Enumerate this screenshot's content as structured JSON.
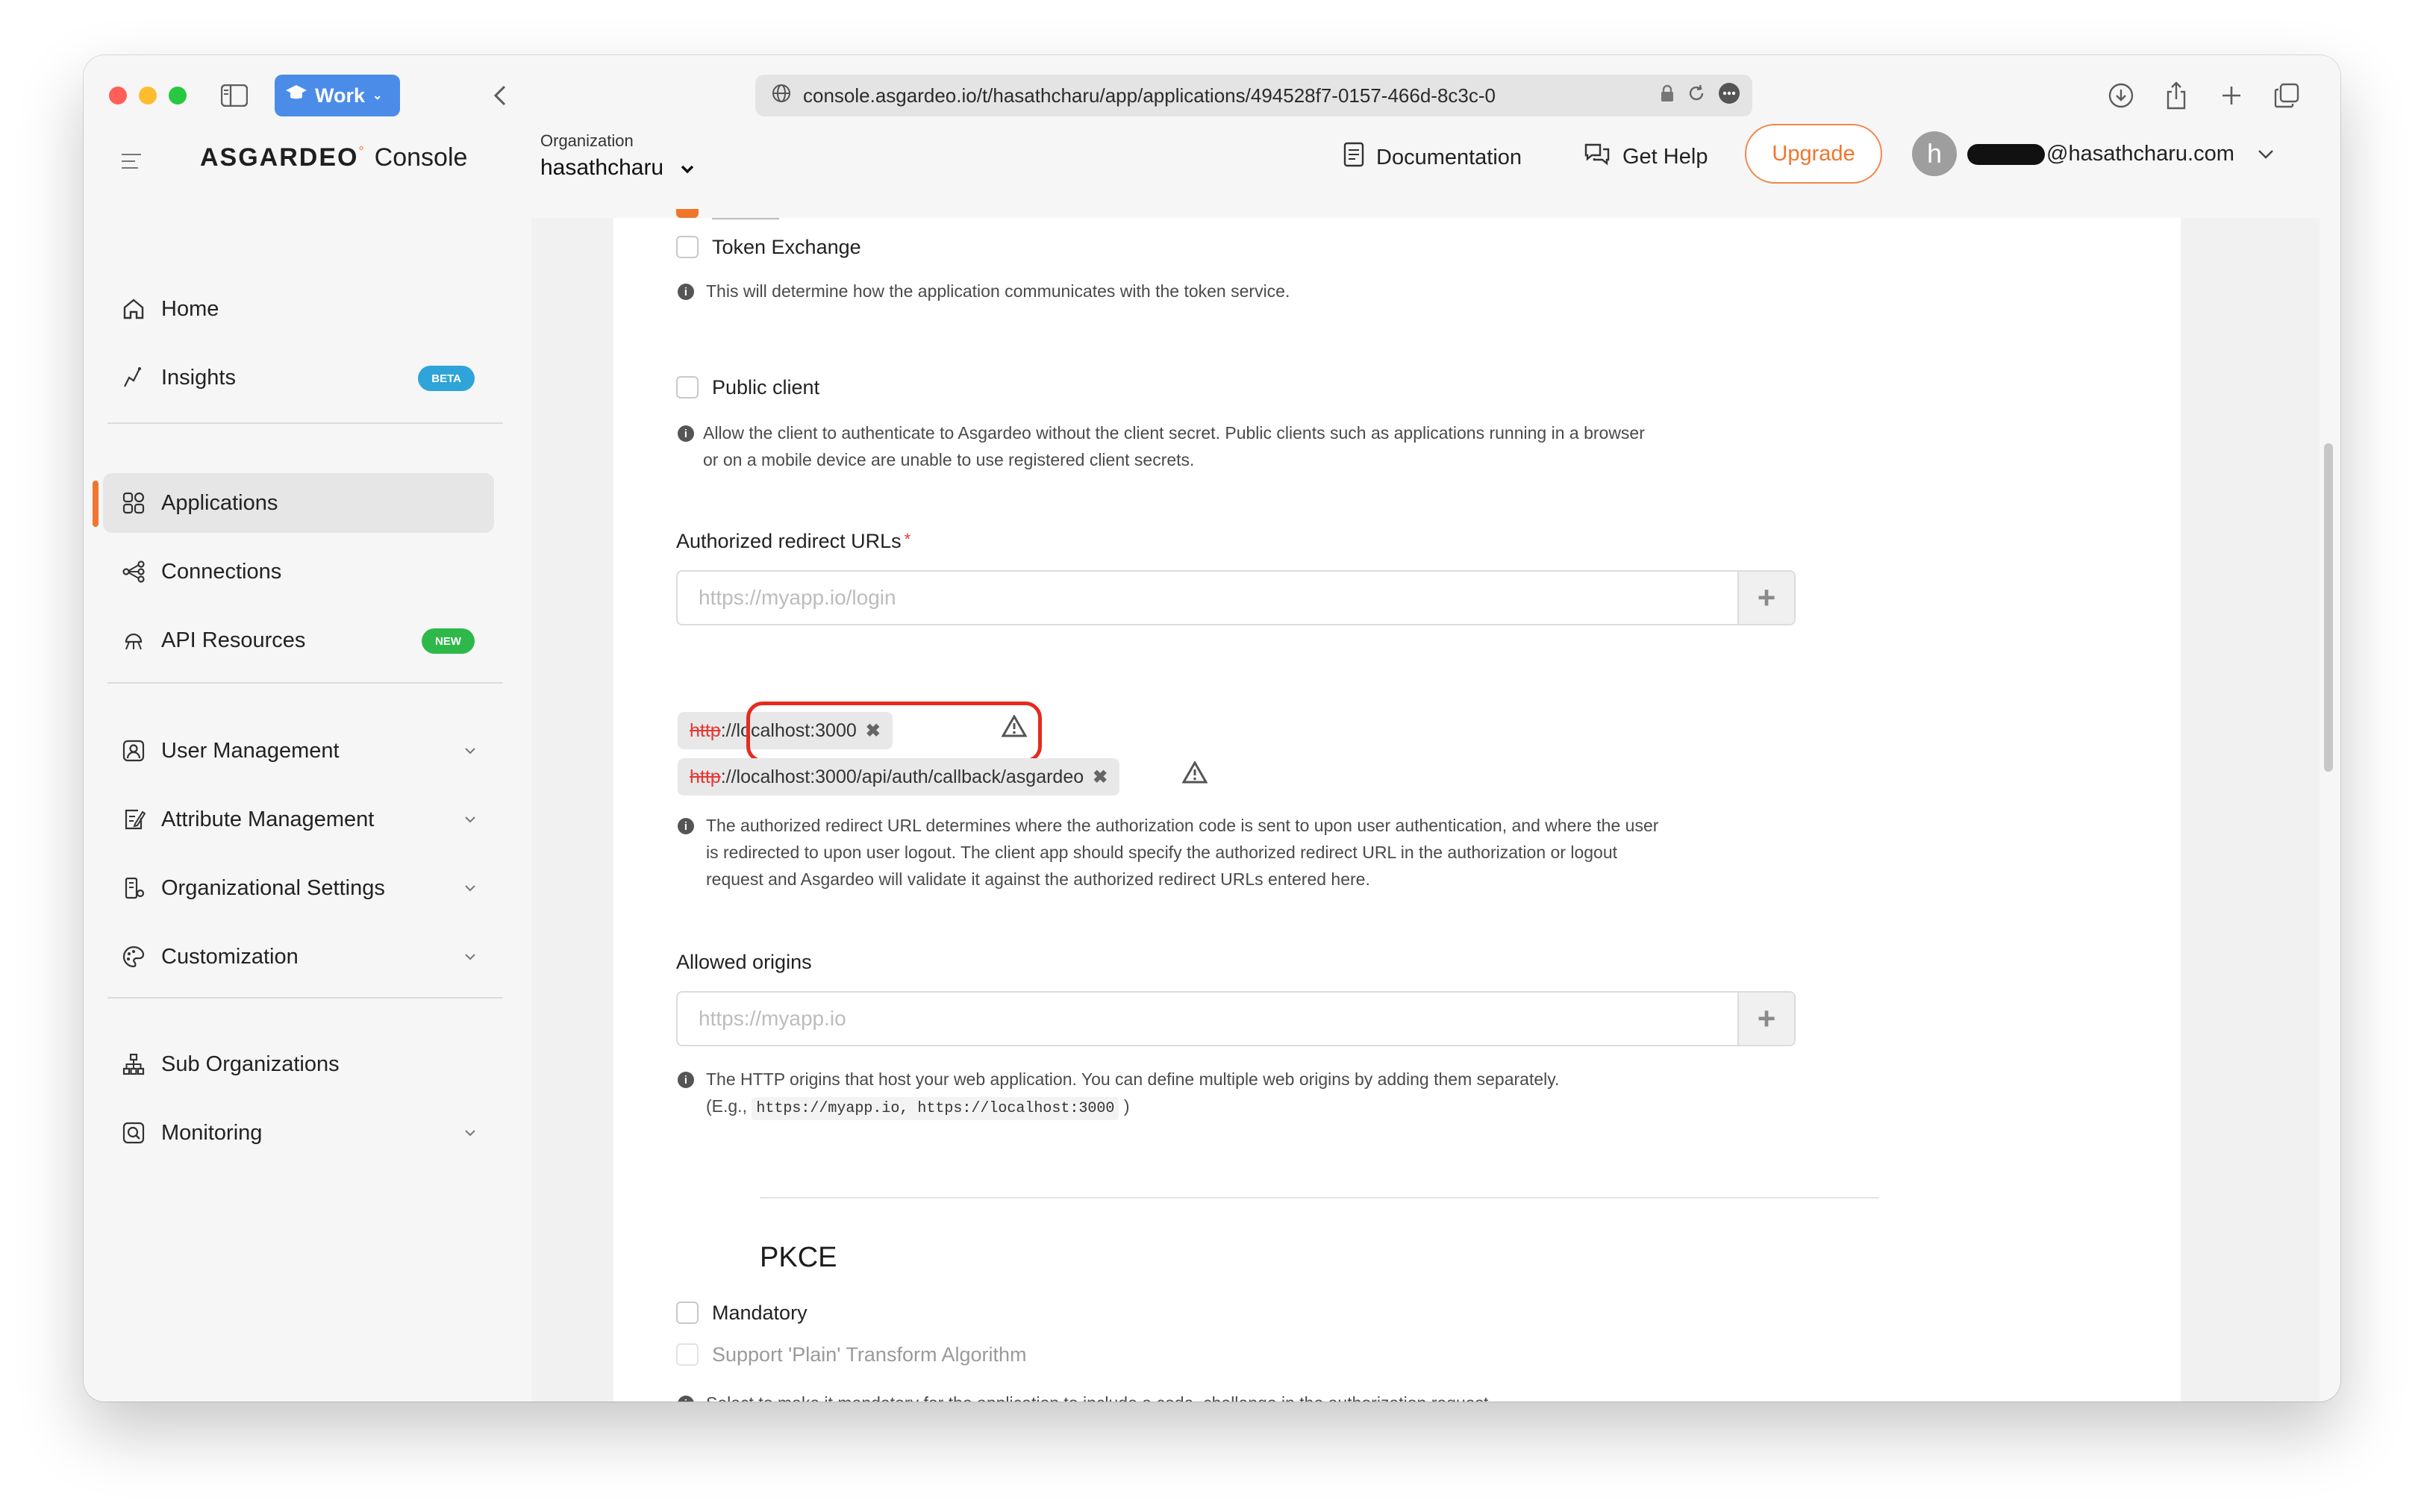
{
  "browser": {
    "profile_label": "Work",
    "url": "console.asgardeo.io/t/hasathcharu/app/applications/494528f7-0157-466d-8c3c-0"
  },
  "header": {
    "brand_logo": "ASGARDEO",
    "brand_product": "Console",
    "org_label": "Organization",
    "org_value": "hasathcharu",
    "documentation": "Documentation",
    "get_help": "Get Help",
    "upgrade": "Upgrade",
    "avatar_letter": "h",
    "user_email_suffix": "@hasathcharu.com"
  },
  "sidebar": {
    "items": [
      {
        "label": "Home"
      },
      {
        "label": "Insights",
        "badge": "BETA"
      },
      {
        "label": "Applications"
      },
      {
        "label": "Connections"
      },
      {
        "label": "API Resources",
        "badge": "NEW"
      },
      {
        "label": "User Management"
      },
      {
        "label": "Attribute Management"
      },
      {
        "label": "Organizational Settings"
      },
      {
        "label": "Customization"
      },
      {
        "label": "Sub Organizations"
      },
      {
        "label": "Monitoring"
      }
    ]
  },
  "main": {
    "token_exchange": "Token Exchange",
    "grant_hint": "This will determine how the application communicates with the token service.",
    "public_client": "Public client",
    "public_client_hint_1": "Allow the client to authenticate to Asgardeo without the client secret. Public clients such as applications running in a browser",
    "public_client_hint_2": "or on a mobile device are unable to use registered client secrets.",
    "redirect_label": "Authorized redirect URLs",
    "required_mark": "*",
    "redirect_placeholder": "https://myapp.io/login",
    "redirect_urls": [
      {
        "proto": "http",
        "rest": "://localhost:3000"
      },
      {
        "proto": "http",
        "rest": "://localhost:3000/api/auth/callback/asgardeo"
      }
    ],
    "redirect_hint_1": "The authorized redirect URL determines where the authorization code is sent to upon user authentication, and where the user",
    "redirect_hint_2": "is redirected to upon user logout. The client app should specify the authorized redirect URL in the authorization or logout",
    "redirect_hint_3": "request and Asgardeo will validate it against the authorized redirect URLs entered here.",
    "origins_label": "Allowed origins",
    "origins_placeholder": "https://myapp.io",
    "origins_hint_1": "The HTTP origins that host your web application. You can define multiple web origins by adding them separately.",
    "origins_hint_eg": "(E.g.,",
    "origins_hint_code": "https://myapp.io, https://localhost:3000",
    "origins_hint_close": ")",
    "pkce_title": "PKCE",
    "pkce_mandatory": "Mandatory",
    "pkce_plain": "Support 'Plain' Transform Algorithm",
    "pkce_hint": "Select to make it mandatory for the application to include a code_challenge in the authorization request."
  },
  "colors": {
    "accent": "#f0762e",
    "work_pill": "#4b8ce8",
    "highlight": "#e52b1e",
    "beta_badge": "#2fa4d8",
    "new_badge": "#2fb84a"
  }
}
